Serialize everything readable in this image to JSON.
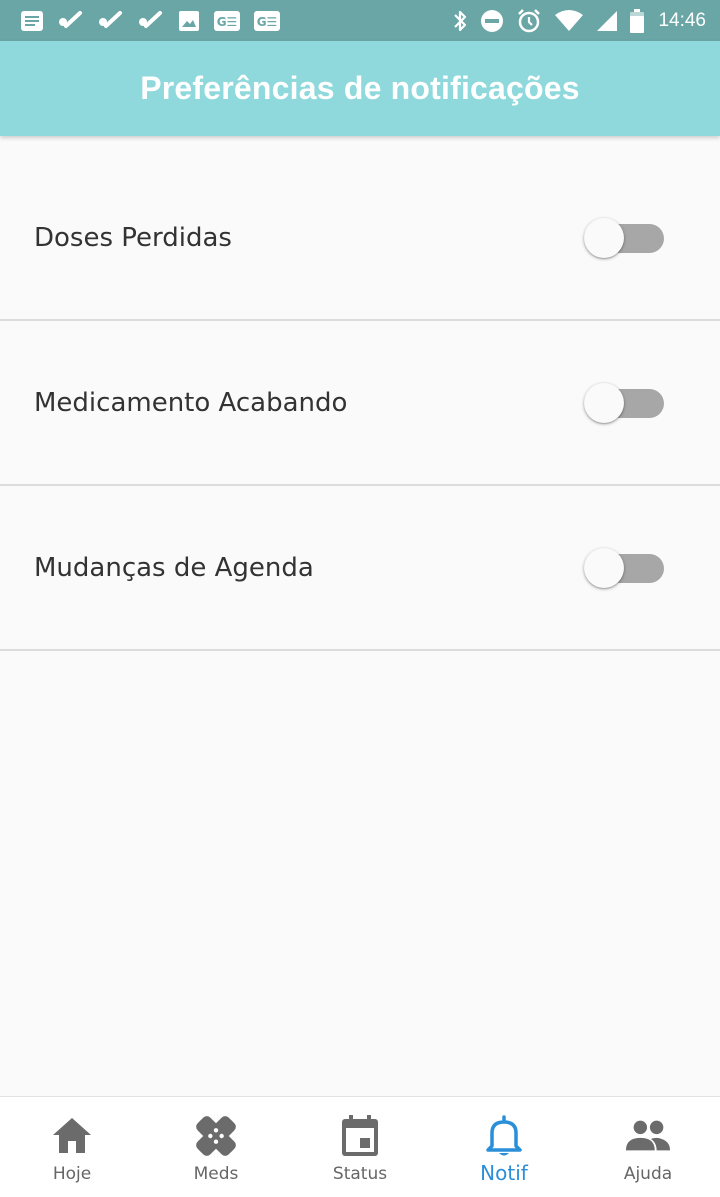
{
  "status_bar": {
    "time": "14:46",
    "left_icons": [
      "message-icon",
      "check-icon",
      "check-icon",
      "check-icon",
      "image-icon",
      "ge-icon",
      "ge-icon"
    ],
    "right_icons": [
      "bluetooth-icon",
      "do-not-disturb-icon",
      "alarm-icon",
      "wifi-icon",
      "signal-icon",
      "battery-icon"
    ],
    "ge_text": "G☰"
  },
  "app_bar": {
    "title": "Preferências de notificações",
    "color": "#8fd9dc"
  },
  "preferences": [
    {
      "label": "Doses Perdidas",
      "enabled": false
    },
    {
      "label": "Medicamento Acabando",
      "enabled": false
    },
    {
      "label": "Mudanças de Agenda",
      "enabled": false
    }
  ],
  "bottom_nav": {
    "active_color": "#2a8fd8",
    "items": [
      {
        "label": "Hoje",
        "icon": "home-icon",
        "active": false
      },
      {
        "label": "Meds",
        "icon": "bandage-icon",
        "active": false
      },
      {
        "label": "Status",
        "icon": "calendar-icon",
        "active": false
      },
      {
        "label": "Notif",
        "icon": "bell-icon",
        "active": true
      },
      {
        "label": "Ajuda",
        "icon": "people-icon",
        "active": false
      }
    ]
  }
}
